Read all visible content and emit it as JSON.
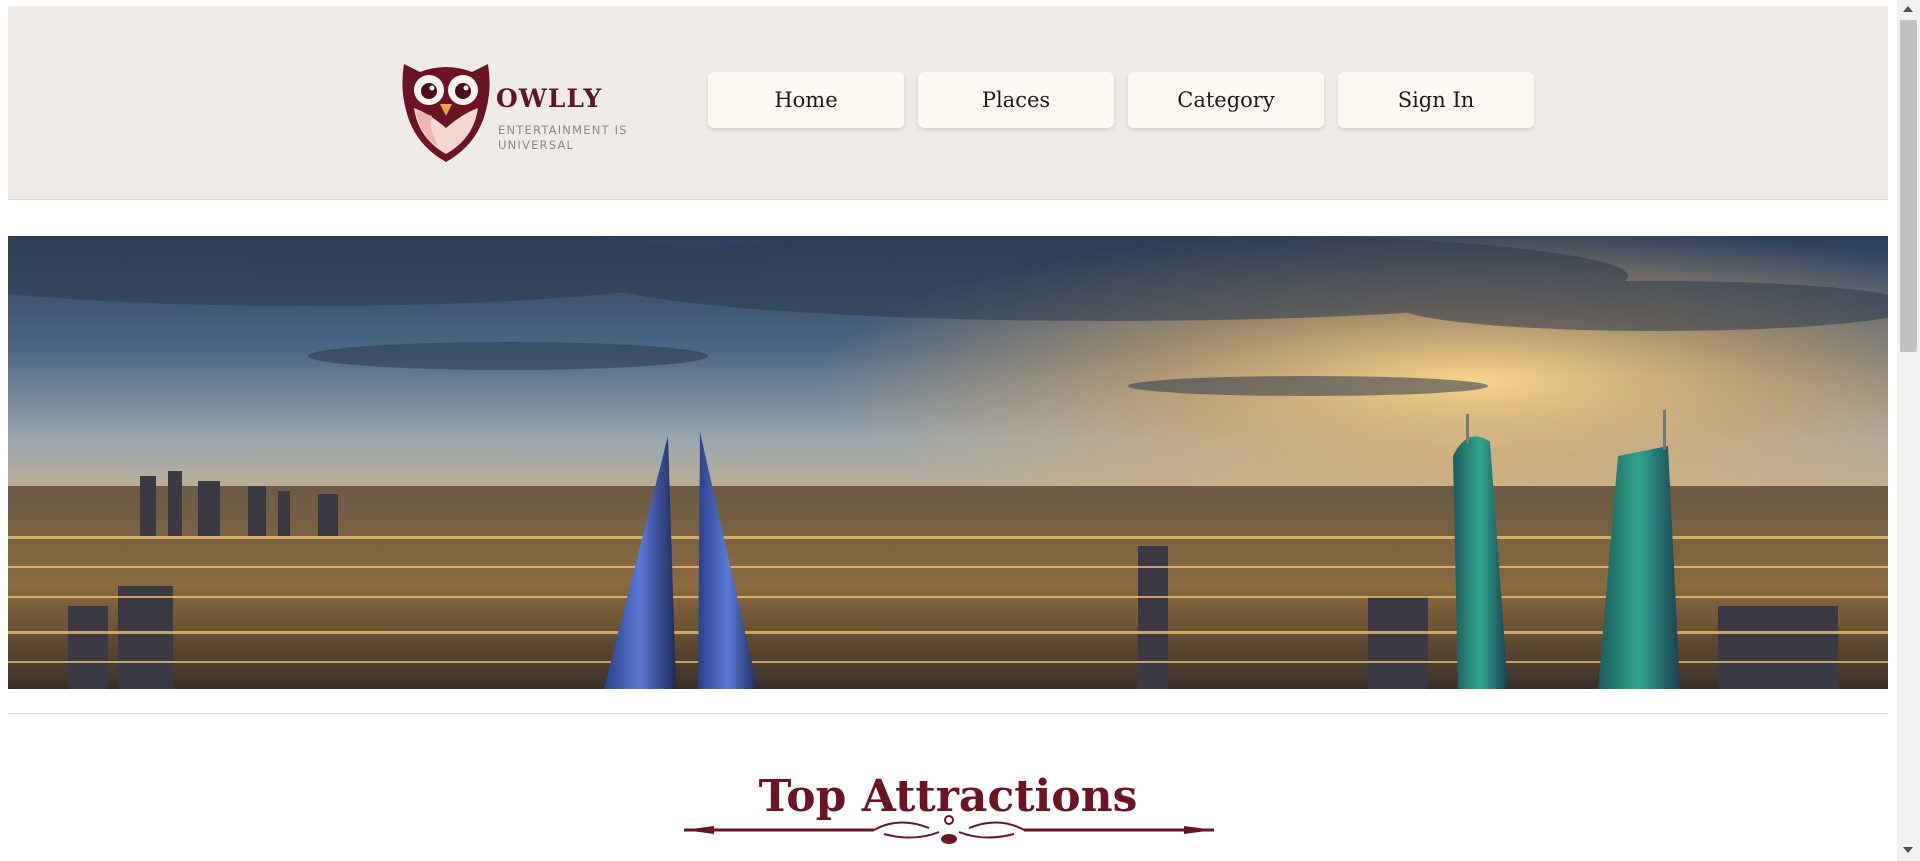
{
  "brand": {
    "name": "OWLLY",
    "tagline": "ENTERTAINMENT IS UNIVERSAL",
    "colors": {
      "primary": "#6a1424",
      "header_bg": "#efebe8",
      "nav_bg": "#fdf8f1"
    }
  },
  "nav": {
    "items": [
      {
        "label": "Home"
      },
      {
        "label": "Places"
      },
      {
        "label": "Category"
      },
      {
        "label": "Sign In"
      }
    ]
  },
  "hero": {
    "image": "city-skyline-at-sunset"
  },
  "section": {
    "title": "Top Attractions"
  }
}
